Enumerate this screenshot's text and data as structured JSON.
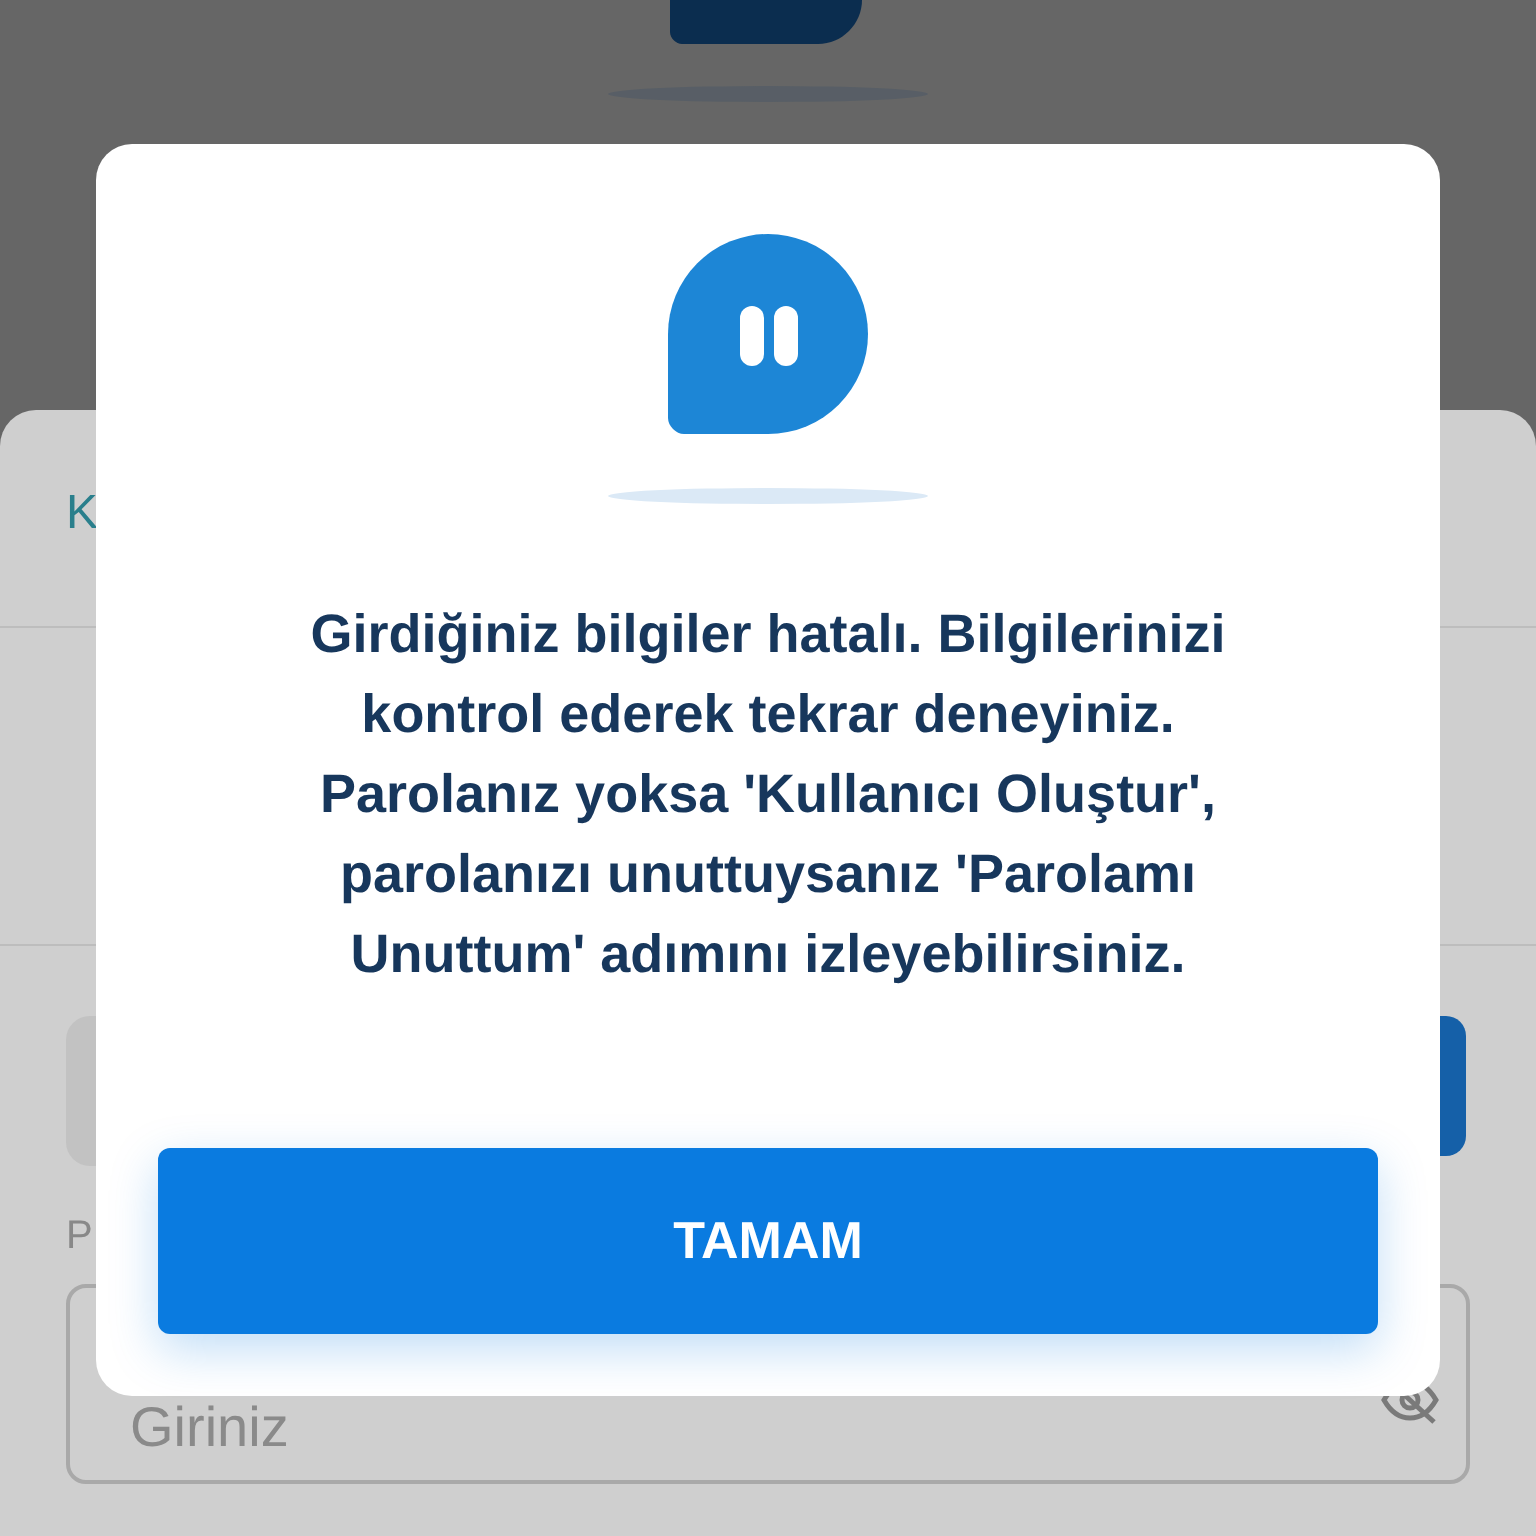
{
  "background": {
    "tab_label": "K",
    "field_label": "P",
    "password_field": {
      "placeholder": "Giriniz"
    }
  },
  "dialog": {
    "message": "Girdiğiniz bilgiler hatalı. Bilgilerinizi kontrol ederek tekrar deneyiniz. Parolanız yoksa 'Kullanıcı Oluştur', parolanızı unuttuysanız 'Parolamı Unuttum' adımını izleyebilirsiniz.",
    "button": "TAMAM"
  }
}
